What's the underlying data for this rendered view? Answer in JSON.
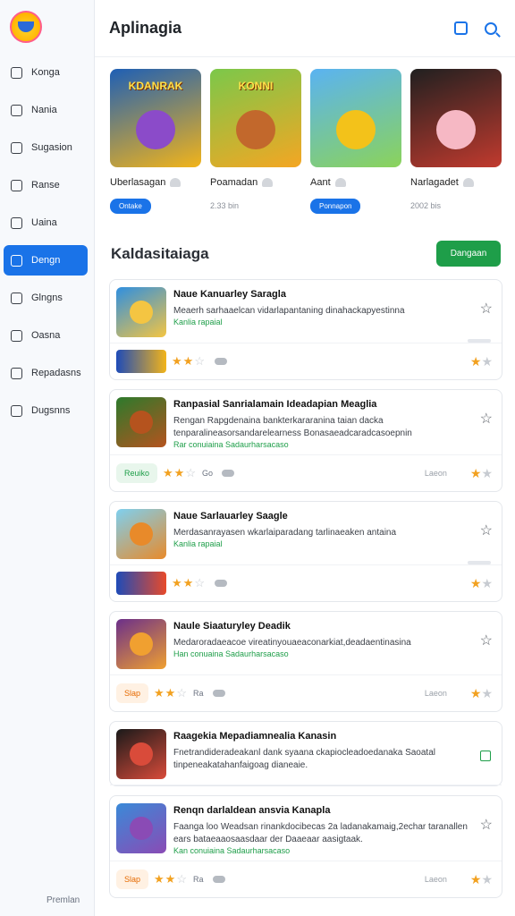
{
  "app": {
    "title": "Aplinagia"
  },
  "sidebar": {
    "items": [
      {
        "label": "Konga",
        "icon": "home-icon"
      },
      {
        "label": "Nania",
        "icon": "grid-icon"
      },
      {
        "label": "Sugasion",
        "icon": "edit-icon"
      },
      {
        "label": "Ranse",
        "icon": "gem-icon"
      },
      {
        "label": "Uaina",
        "icon": "shield-icon"
      },
      {
        "label": "Dengn",
        "icon": "square-icon",
        "active": true
      },
      {
        "label": "Glngns",
        "icon": "note-icon"
      },
      {
        "label": "Oasna",
        "icon": "copy-icon"
      },
      {
        "label": "Repadasns",
        "icon": "list-icon"
      },
      {
        "label": "Dugsnns",
        "icon": "badge-icon"
      }
    ],
    "footer": "Premlan"
  },
  "featured": [
    {
      "title": "Uberlasagan",
      "badge": "Ontake",
      "meta_type": "pill",
      "img_title": "KDANRAK",
      "bg": [
        "#1e5fb5",
        "#f2b41a"
      ],
      "char": "#8b4bc9"
    },
    {
      "title": "Poamadan",
      "badge": "2.33 bin",
      "meta_type": "text",
      "img_title": "KONNI",
      "bg": [
        "#7bc84a",
        "#f4a623"
      ],
      "char": "#c2682c"
    },
    {
      "title": "Aant",
      "badge": "Ponnapon",
      "meta_type": "pill",
      "img_title": "",
      "bg": [
        "#5ab3f2",
        "#8bd35a"
      ],
      "char": "#f3c21a"
    },
    {
      "title": "Narlagadet",
      "badge": "2002 bis",
      "meta_type": "text",
      "img_title": "",
      "bg": [
        "#202020",
        "#c13a2e"
      ],
      "char": "#f6b8c4"
    }
  ],
  "section": {
    "title": "Kaldasitaiaga",
    "button": "Dangaan"
  },
  "list": [
    {
      "title": "Naue Kanuarley Saragla",
      "desc": "Meaerh sarhaaelcan vidarlapantaning dinahackapyestinna",
      "green": "Kanlia rapaial",
      "tag": "",
      "stars": 2,
      "hint": "",
      "rating_text": "",
      "fav": "star",
      "thumb": [
        "#2f8fe0",
        "#f4c542"
      ],
      "mini": [
        "#1e4bb8",
        "#f2b41a"
      ]
    },
    {
      "title": "Ranpasial Sanrialamain Ideadapian Meaglia",
      "desc": "Rengan Rapgdenaina bankterkararanina taian dacka tenparalineasorsandarelearness Bonasaeadcaradcasoepnin",
      "green": "Rar conuiaina Sadaurharsacaso",
      "tag": "Reuiko",
      "stars": 2,
      "hint": "Go",
      "rating_text": "Laeon",
      "fav": "star",
      "thumb": [
        "#2c7a2c",
        "#b5531e"
      ],
      "mini": []
    },
    {
      "title": "Naue Sarlauarley Saagle",
      "desc": "Merdasanrayasen wkarlaiparadang tarlinaeaken antaina",
      "green": "Kanlia rapaial",
      "tag": "",
      "stars": 2,
      "hint": "",
      "rating_text": "",
      "fav": "star",
      "thumb": [
        "#7ed0f0",
        "#e88a2a"
      ],
      "mini": [
        "#1e4bb8",
        "#e84a2a"
      ]
    },
    {
      "title": "Naule Siaaturyley Deadik",
      "desc": "Medaroradaeacoe vireatinyouaeaconarkiat,deadaentinasina",
      "green": "Han conuaina Sadaurharsacaso",
      "tag": "Slap",
      "stars": 2,
      "hint": "Ra",
      "rating_text": "Laeon",
      "fav": "star",
      "thumb": [
        "#6b2f8a",
        "#f0a030"
      ],
      "mini": []
    },
    {
      "title": "Raagekia Mepadiamnealia Kanasin",
      "desc": "Fnetrandideradeakanl dank syaana ckapiocleadoedanaka Saoatal tinpeneakatahanfaigoag dianeaie.",
      "green": "",
      "tag": "",
      "stars": 0,
      "hint": "",
      "rating_text": "",
      "fav": "square",
      "thumb": [
        "#1a1a1a",
        "#d94b3a"
      ],
      "mini": []
    },
    {
      "title": "Renqn darlaldean ansvia Kanapla",
      "desc": "Faanga loo Weadsan rinankdocibecas 2a ladanakamaig,2echar taranallen ears bataeaaosaasdaar der Daaeaar aasigtaak.",
      "green": "Kan conuiaina Sadaurharsacaso",
      "tag": "Slap",
      "stars": 2,
      "hint": "Ra",
      "rating_text": "Laeon",
      "fav": "star",
      "thumb": [
        "#3a8ad8",
        "#8a4bb5"
      ],
      "mini": []
    }
  ]
}
